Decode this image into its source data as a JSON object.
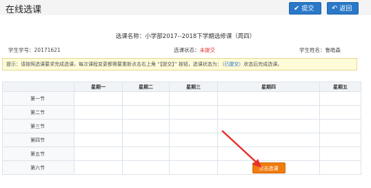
{
  "header": {
    "title": "在线选课",
    "submit_label": "提交",
    "back_label": "返回"
  },
  "course": {
    "title": "选课名称：小学部2017--2018下学期选修课（周四）"
  },
  "info": {
    "student_id_label": "学生学号：",
    "student_id": "20171621",
    "status_label": "选课状态：",
    "status": "未提交",
    "name_label": "学生姓名：",
    "name": "鲁皓森"
  },
  "tip": {
    "prefix": "提示：请按照选课要求完成选课，每次课程变更都需要重新点击右上角 “【提交】” 按钮，选课状态为：（",
    "submitted": "已提交",
    "suffix": "）状态后完成选课。"
  },
  "table": {
    "headers": [
      "",
      "星期一",
      "星期二",
      "星期三",
      "星期四",
      "星期五"
    ],
    "periods": [
      "第一节",
      "第二节",
      "第三节",
      "第四节",
      "第五节",
      "第六节"
    ],
    "select_label": "点击选课"
  },
  "colors": {
    "primary": "#2a78c8",
    "select": "#f07c10",
    "alert": "#e03030",
    "arrow": "#e8302c"
  }
}
